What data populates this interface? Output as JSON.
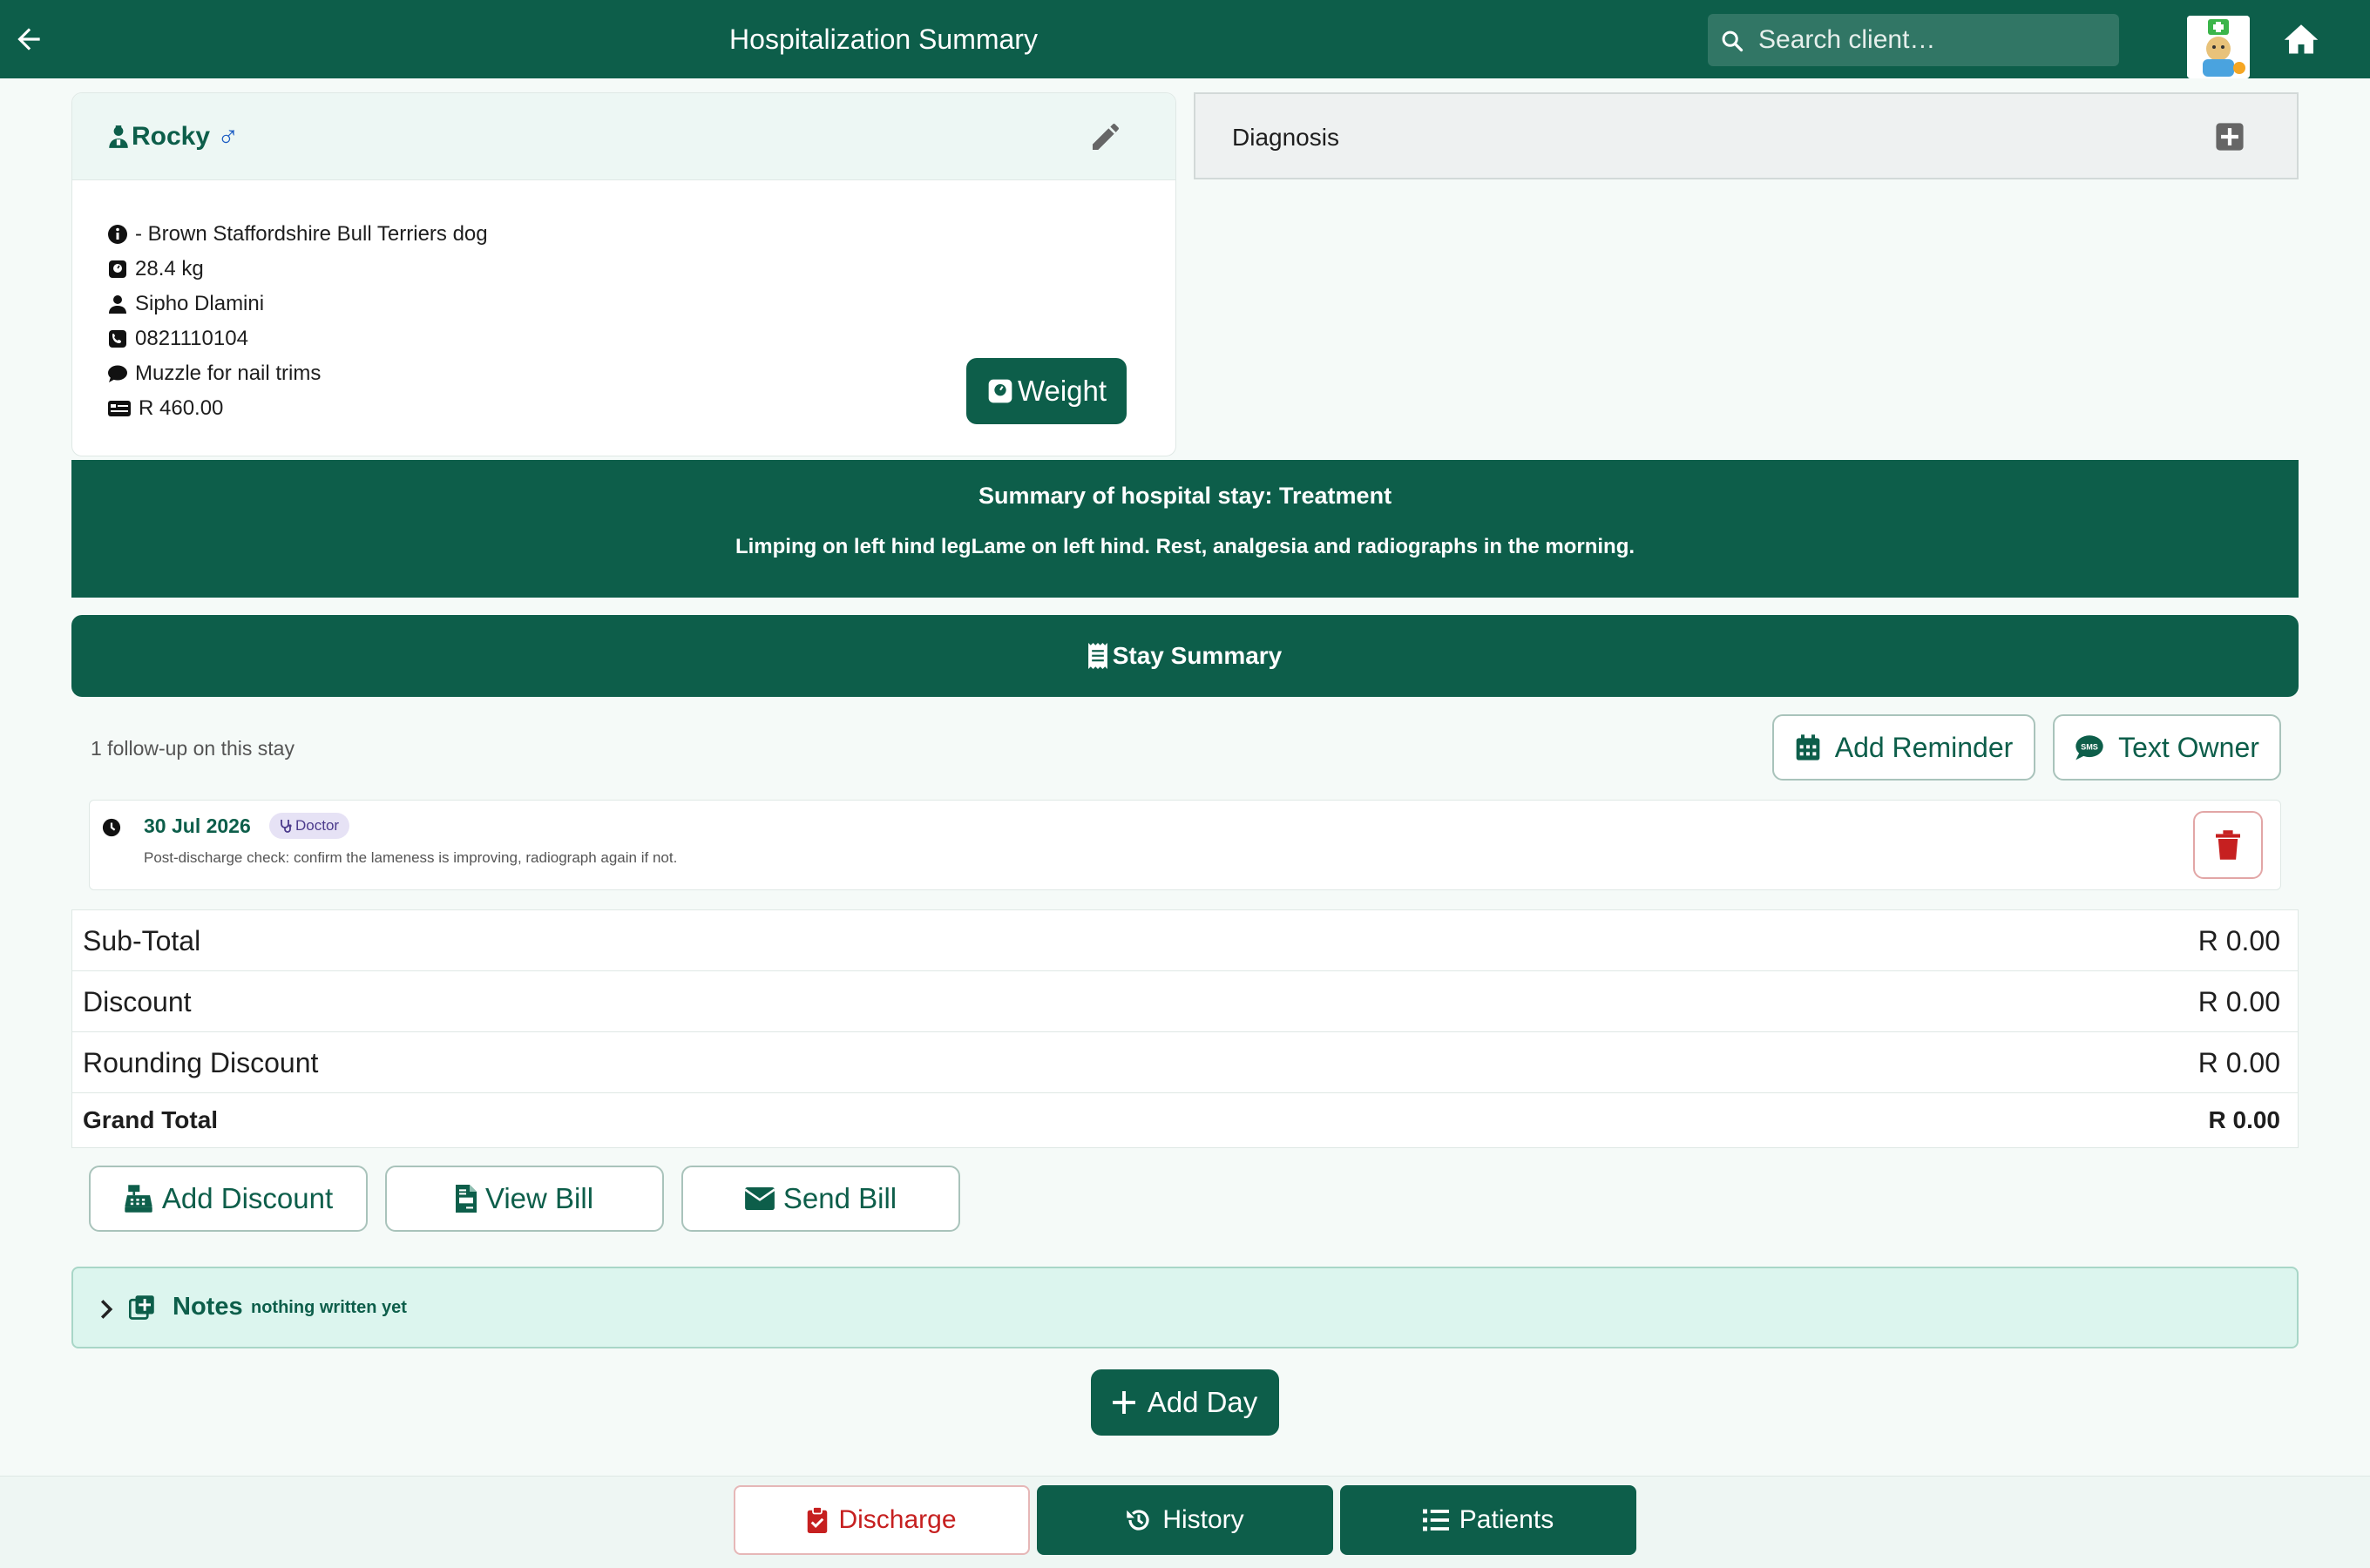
{
  "header": {
    "title": "Hospitalization Summary",
    "search_placeholder": "Search client…"
  },
  "patient": {
    "name": "Rocky",
    "sex_symbol": "♂",
    "breed": "- Brown Staffordshire Bull Terriers dog",
    "weight": "28.4 kg",
    "owner": "Sipho Dlamini",
    "phone": "0821110104",
    "note": "Muzzle for nail trims",
    "balance": "R 460.00",
    "weight_button": "Weight"
  },
  "diagnosis": {
    "label": "Diagnosis"
  },
  "summary": {
    "title": "Summary of hospital stay: Treatment",
    "text": "Limping on left hind legLame on left hind. Rest, analgesia and radiographs in the morning."
  },
  "stay_summary": {
    "label": "Stay Summary"
  },
  "followups": {
    "count_text": "1 follow-up on this stay",
    "add_reminder": "Add Reminder",
    "text_owner": "Text Owner",
    "items": [
      {
        "date": "30 Jul 2026",
        "badge": "Doctor",
        "note": "Post-discharge check: confirm the lameness is improving, radiograph again if not."
      }
    ]
  },
  "totals": {
    "rows": [
      {
        "label": "Sub-Total",
        "value": "R 0.00"
      },
      {
        "label": "Discount",
        "value": "R 0.00"
      },
      {
        "label": "Rounding Discount",
        "value": "R 0.00"
      },
      {
        "label": "Grand Total",
        "value": "R 0.00"
      }
    ]
  },
  "bill_actions": {
    "add_discount": "Add Discount",
    "view_bill": "View Bill",
    "send_bill": "Send Bill"
  },
  "notes": {
    "title": "Notes",
    "subtitle": "nothing written yet"
  },
  "add_day": "Add Day",
  "bottom": {
    "discharge": "Discharge",
    "history": "History",
    "patients": "Patients"
  },
  "colors": {
    "brand": "#0d5e4a",
    "danger": "#c62020",
    "notes_bg": "#dcf5ee"
  }
}
